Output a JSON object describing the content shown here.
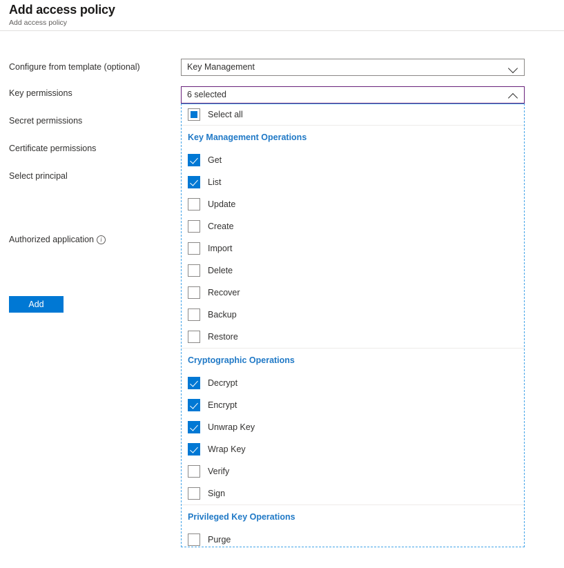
{
  "header": {
    "title": "Add access policy",
    "subtitle": "Add access policy"
  },
  "form": {
    "labels": {
      "template": "Configure from template (optional)",
      "key_permissions": "Key permissions",
      "secret_permissions": "Secret permissions",
      "certificate_permissions": "Certificate permissions",
      "select_principal": "Select principal",
      "authorized_application": "Authorized application"
    },
    "template_value": "Key Management",
    "key_permissions_value": "6 selected",
    "info_glyph": "i"
  },
  "dropdown": {
    "select_all_label": "Select all",
    "select_all_state": "indeterminate",
    "sections": [
      {
        "title": "Key Management Operations",
        "items": [
          {
            "label": "Get",
            "checked": true
          },
          {
            "label": "List",
            "checked": true
          },
          {
            "label": "Update",
            "checked": false
          },
          {
            "label": "Create",
            "checked": false
          },
          {
            "label": "Import",
            "checked": false
          },
          {
            "label": "Delete",
            "checked": false
          },
          {
            "label": "Recover",
            "checked": false
          },
          {
            "label": "Backup",
            "checked": false
          },
          {
            "label": "Restore",
            "checked": false
          }
        ]
      },
      {
        "title": "Cryptographic Operations",
        "items": [
          {
            "label": "Decrypt",
            "checked": true
          },
          {
            "label": "Encrypt",
            "checked": true
          },
          {
            "label": "Unwrap Key",
            "checked": true
          },
          {
            "label": "Wrap Key",
            "checked": true
          },
          {
            "label": "Verify",
            "checked": false
          },
          {
            "label": "Sign",
            "checked": false
          }
        ]
      },
      {
        "title": "Privileged Key Operations",
        "items": [
          {
            "label": "Purge",
            "checked": false
          }
        ]
      }
    ]
  },
  "actions": {
    "add_label": "Add"
  },
  "colors": {
    "accent": "#0078d4",
    "section_header": "#2079c6",
    "focus_border": "#68217a",
    "panel_border": "#41a3e8"
  }
}
